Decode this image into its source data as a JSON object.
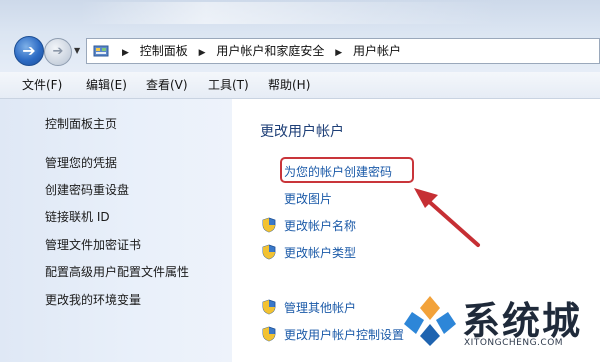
{
  "address_bar": {
    "breadcrumbs": [
      "控制面板",
      "用户帐户和家庭安全",
      "用户帐户"
    ]
  },
  "menu": [
    "文件(F)",
    "编辑(E)",
    "查看(V)",
    "工具(T)",
    "帮助(H)"
  ],
  "left_pane": {
    "links": [
      "控制面板主页",
      "管理您的凭据",
      "创建密码重设盘",
      "链接联机 ID",
      "管理文件加密证书",
      "配置高级用户配置文件属性",
      "更改我的环境变量"
    ]
  },
  "main": {
    "heading": "更改用户帐户",
    "tasks": [
      {
        "label": "为您的帐户创建密码",
        "icon": "none",
        "highlighted": true
      },
      {
        "label": "更改图片",
        "icon": "none"
      },
      {
        "label": "更改帐户名称",
        "icon": "shield-icon"
      },
      {
        "label": "更改帐户类型",
        "icon": "shield-icon"
      }
    ],
    "other_tasks": [
      {
        "label": "管理其他帐户",
        "icon": "shield-icon"
      },
      {
        "label": "更改用户帐户控制设置",
        "icon": "shield-icon"
      }
    ]
  },
  "watermark": {
    "title": "系统城",
    "subtitle": "XITONGCHENG.COM"
  },
  "colors": {
    "link": "#1b5aa8",
    "heading": "#1e3f77",
    "highlight": "#c9353a"
  }
}
